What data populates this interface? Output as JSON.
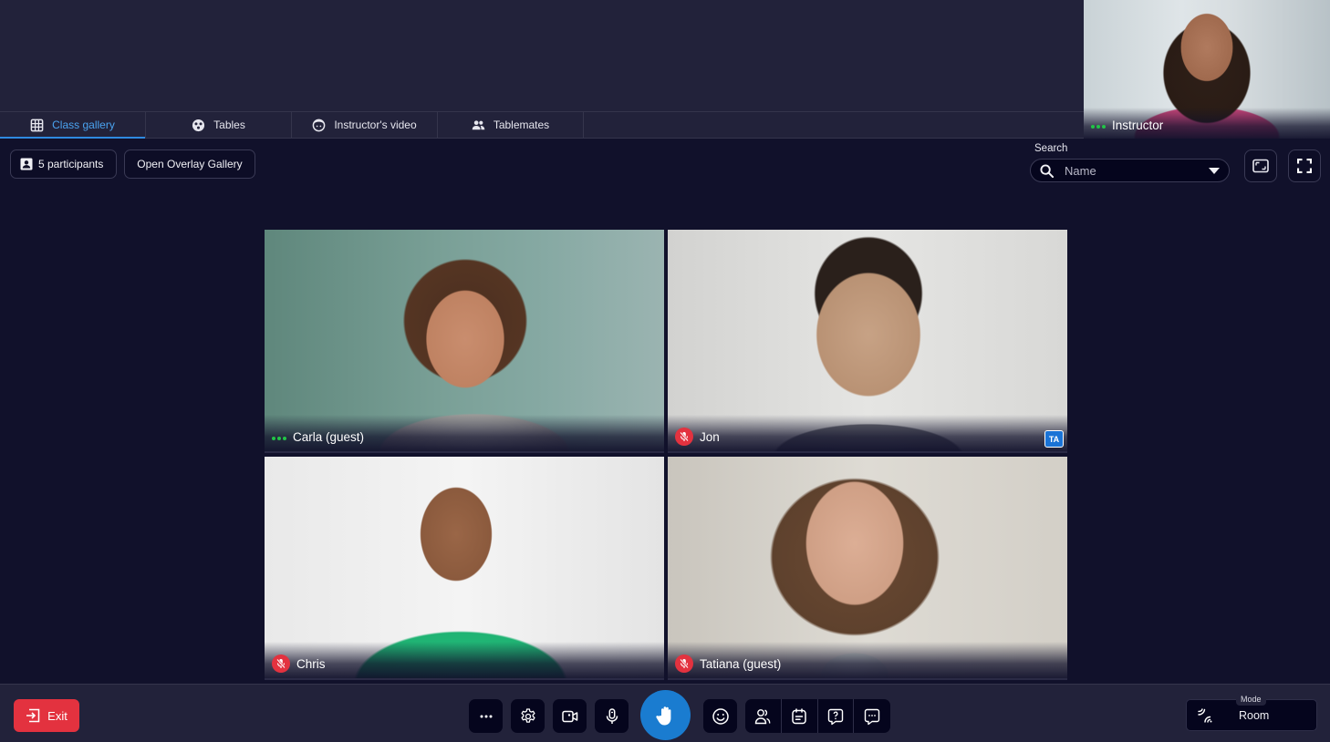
{
  "tabs": [
    {
      "label": "Class gallery",
      "icon": "grid-icon",
      "active": true
    },
    {
      "label": "Tables",
      "icon": "tables-icon",
      "active": false
    },
    {
      "label": "Instructor's video",
      "icon": "face-icon",
      "active": false
    },
    {
      "label": "Tablemates",
      "icon": "people-icon",
      "active": false
    }
  ],
  "instructor": {
    "name": "Instructor",
    "status": "speaking"
  },
  "toolbar": {
    "participants_label": "5 participants",
    "overlay_gallery_label": "Open Overlay Gallery",
    "search_label": "Search",
    "search_placeholder": "Name"
  },
  "participants": [
    {
      "name": "Carla (guest)",
      "status": "speaking",
      "muted": false,
      "badge": ""
    },
    {
      "name": "Jon",
      "status": "muted",
      "muted": true,
      "badge": "TA"
    },
    {
      "name": "Chris",
      "status": "muted",
      "muted": true,
      "badge": ""
    },
    {
      "name": "Tatiana (guest)",
      "status": "muted",
      "muted": true,
      "badge": ""
    }
  ],
  "bottom_bar": {
    "exit_label": "Exit",
    "controls": [
      "more-options",
      "settings",
      "camera",
      "microphone",
      "raise-hand",
      "reactions",
      "participants",
      "agenda",
      "questions",
      "chat"
    ],
    "mode_label": "Mode",
    "mode_value": "Room"
  },
  "colors": {
    "accent": "#2f8ae0",
    "exit": "#e3323f",
    "raise_hand": "#1a7cd0",
    "speaking": "#22c447",
    "muted": "#e3323f",
    "ta_badge": "#1a73d6"
  }
}
